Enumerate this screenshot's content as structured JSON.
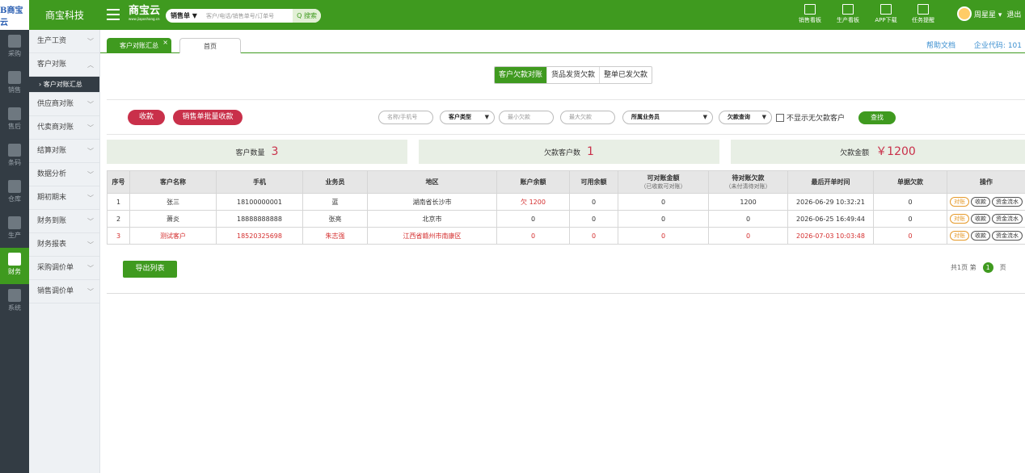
{
  "top": {
    "logo": "B商宝云",
    "company": "商宝科技",
    "brand": "商宝云",
    "brand_sub": "www.jiaposhang.cn",
    "search_type": "销售单 ▼",
    "search_placeholder": "客户/电话/销售单号/订单号",
    "search_btn": "Q 搜索",
    "tools": [
      "销售看板",
      "生产看板",
      "APP下载",
      "任务提醒"
    ],
    "user": "周星星 ▾",
    "logout": "退出"
  },
  "leftnav": [
    {
      "label": "采购",
      "icon": "cart-icon",
      "active": false
    },
    {
      "label": "销售",
      "icon": "building-icon",
      "active": false
    },
    {
      "label": "售后",
      "icon": "building-icon",
      "active": false
    },
    {
      "label": "条码",
      "icon": "barcode-icon",
      "active": false
    },
    {
      "label": "仓库",
      "icon": "warehouse-icon",
      "active": false
    },
    {
      "label": "生产",
      "icon": "factory-icon",
      "active": false
    },
    {
      "label": "财务",
      "icon": "calculator-icon",
      "active": true
    },
    {
      "label": "系统",
      "icon": "gear-icon",
      "active": false
    }
  ],
  "subnav": [
    {
      "label": "生产工资",
      "chev": "﹀"
    },
    {
      "label": "客户对账",
      "chev": "︿"
    },
    {
      "label": "› 客户对账汇总",
      "sub": true
    },
    {
      "label": "供应商对账",
      "chev": "﹀"
    },
    {
      "label": "代卖商对账",
      "chev": "﹀"
    },
    {
      "label": "结算对账",
      "chev": "﹀"
    },
    {
      "label": "数据分析",
      "chev": "﹀"
    },
    {
      "label": "期初期末",
      "chev": "﹀"
    },
    {
      "label": "财务到账",
      "chev": "﹀"
    },
    {
      "label": "财务报表",
      "chev": "﹀"
    },
    {
      "label": "采购调价单",
      "chev": "﹀"
    },
    {
      "label": "销售调价单",
      "chev": "﹀"
    }
  ],
  "tabs": {
    "active": "客户对账汇总",
    "other": "首页",
    "close": "×"
  },
  "help": "帮助文档",
  "corp": "企业代码: 101",
  "segments": [
    "客户欠款对账",
    "货品发货欠款",
    "整单已发欠款"
  ],
  "filter": {
    "btn_receive": "收款",
    "btn_batch": "销售单批量收款",
    "name_ph": "名称/手机号",
    "cust_type": "客户类型",
    "min_debt": "最小欠款",
    "max_debt": "最大欠款",
    "salesman": "所属业务员",
    "debt_query": "欠款查询",
    "no_debt": "不显示无欠款客户",
    "find": "查找"
  },
  "stats": [
    {
      "label": "客户数量",
      "value": "3"
    },
    {
      "label": "欠款客户数",
      "value": "1"
    },
    {
      "label": "欠款金额",
      "value": "￥1200"
    }
  ],
  "table": {
    "headers": [
      "序号",
      "客户名称",
      "手机",
      "业务员",
      "地区",
      "账户余额",
      "可用余额",
      "可对账金额",
      "待对账欠款",
      "最后开单时间",
      "单据欠款",
      "操作"
    ],
    "header_subs": {
      "7": "（已收款可对账）",
      "8": "（未付清待对账）"
    },
    "rows": [
      {
        "cells": [
          "1",
          "张三",
          "18100000001",
          "蓝",
          "湖南省长沙市",
          "欠 1200",
          "0",
          "0",
          "1200",
          "2026-06-29 10:32:21",
          "0"
        ],
        "red": false
      },
      {
        "cells": [
          "2",
          "萧炎",
          "18888888888",
          "张亮",
          "北京市",
          "0",
          "0",
          "0",
          "0",
          "2026-06-25 16:49:44",
          "0"
        ],
        "red": false
      },
      {
        "cells": [
          "3",
          "测试客户",
          "18520325698",
          "朱志强",
          "江西省赣州市南康区",
          "0",
          "0",
          "0",
          "0",
          "2026-07-03 10:03:48",
          "0"
        ],
        "red": true
      }
    ],
    "ops": [
      "对账",
      "收款",
      "资金流水"
    ]
  },
  "export": "导出列表",
  "pager": {
    "total": "共1页",
    "nth": "第",
    "page": "1",
    "unit": "页"
  }
}
